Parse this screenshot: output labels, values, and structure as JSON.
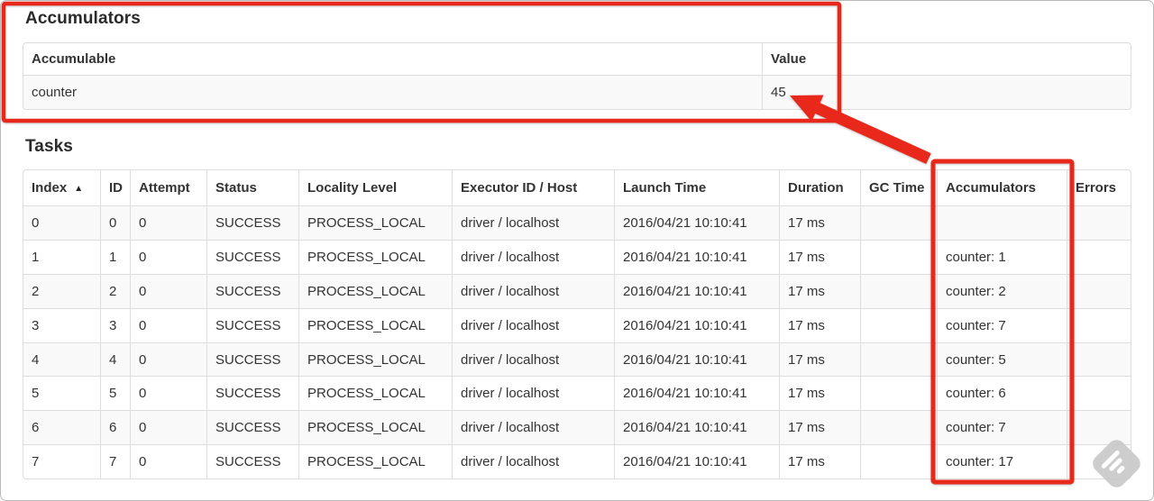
{
  "accumulators_section": {
    "title": "Accumulators",
    "table": {
      "headers": [
        "Accumulable",
        "Value"
      ],
      "rows": [
        [
          "counter",
          "45"
        ]
      ]
    }
  },
  "tasks_section": {
    "title": "Tasks",
    "table": {
      "sort_icon": "▲",
      "sorted_column": "Index",
      "headers": [
        "Index",
        "ID",
        "Attempt",
        "Status",
        "Locality Level",
        "Executor ID / Host",
        "Launch Time",
        "Duration",
        "GC Time",
        "Accumulators",
        "Errors"
      ],
      "rows": [
        [
          "0",
          "0",
          "0",
          "SUCCESS",
          "PROCESS_LOCAL",
          "driver / localhost",
          "2016/04/21 10:10:41",
          "17 ms",
          "",
          "",
          ""
        ],
        [
          "1",
          "1",
          "0",
          "SUCCESS",
          "PROCESS_LOCAL",
          "driver / localhost",
          "2016/04/21 10:10:41",
          "17 ms",
          "",
          "counter: 1",
          ""
        ],
        [
          "2",
          "2",
          "0",
          "SUCCESS",
          "PROCESS_LOCAL",
          "driver / localhost",
          "2016/04/21 10:10:41",
          "17 ms",
          "",
          "counter: 2",
          ""
        ],
        [
          "3",
          "3",
          "0",
          "SUCCESS",
          "PROCESS_LOCAL",
          "driver / localhost",
          "2016/04/21 10:10:41",
          "17 ms",
          "",
          "counter: 7",
          ""
        ],
        [
          "4",
          "4",
          "0",
          "SUCCESS",
          "PROCESS_LOCAL",
          "driver / localhost",
          "2016/04/21 10:10:41",
          "17 ms",
          "",
          "counter: 5",
          ""
        ],
        [
          "5",
          "5",
          "0",
          "SUCCESS",
          "PROCESS_LOCAL",
          "driver / localhost",
          "2016/04/21 10:10:41",
          "17 ms",
          "",
          "counter: 6",
          ""
        ],
        [
          "6",
          "6",
          "0",
          "SUCCESS",
          "PROCESS_LOCAL",
          "driver / localhost",
          "2016/04/21 10:10:41",
          "17 ms",
          "",
          "counter: 7",
          ""
        ],
        [
          "7",
          "7",
          "0",
          "SUCCESS",
          "PROCESS_LOCAL",
          "driver / localhost",
          "2016/04/21 10:10:41",
          "17 ms",
          "",
          "counter: 17",
          ""
        ]
      ]
    }
  },
  "annotations": {
    "color": "#e8281a",
    "highlight_targets": [
      "accumulators-summary-table",
      "tasks-accumulators-column"
    ],
    "arrow_points_at": "45"
  },
  "watermark": {
    "icon": "feedly-style-watermark",
    "color": "#c9c9c9"
  }
}
